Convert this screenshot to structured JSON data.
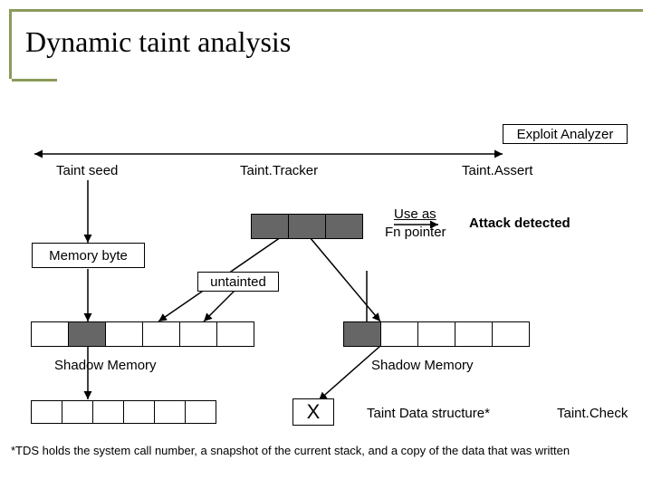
{
  "title": "Dynamic taint analysis",
  "exploit_analyzer": "Exploit Analyzer",
  "taint_seed": "Taint seed",
  "taint_tracker": "Taint.Tracker",
  "taint_assert": "Taint.Assert",
  "use_as": "Use as",
  "fn_pointer": "Fn pointer",
  "attack_detected": "Attack detected",
  "memory_byte": "Memory byte",
  "untainted": "untainted",
  "shadow_memory": "Shadow Memory",
  "x": "X",
  "taint_data_structure": "Taint Data structure",
  "asterisk": "*",
  "taint_check": "Taint.Check",
  "footnote": "*TDS holds the system call number, a snapshot of the current stack, and a copy of the data that was written"
}
